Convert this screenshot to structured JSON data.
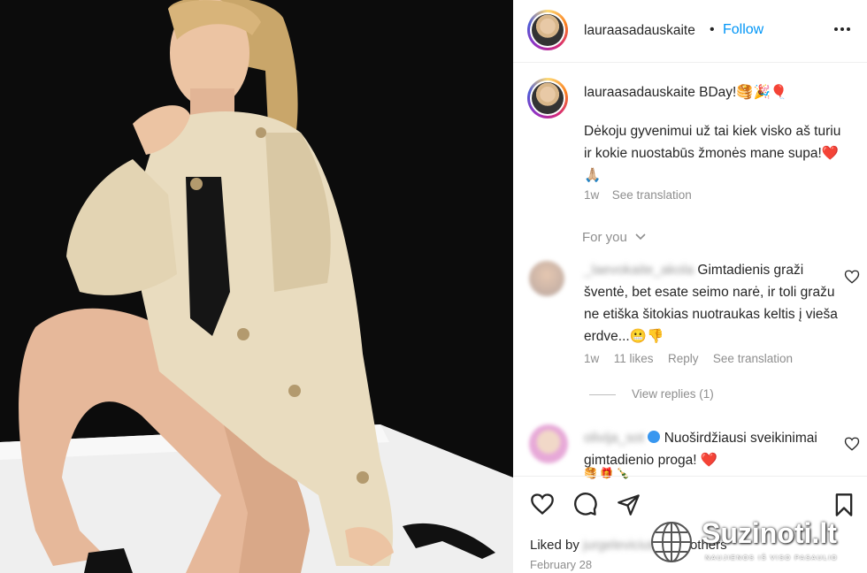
{
  "post": {
    "author": "lauraasadauskaite",
    "separator": "•",
    "follow_label": "Follow",
    "more_icon": "ellipsis-icon",
    "caption": {
      "author": "lauraasadauskaite",
      "text_lead": "BDay!🥞🎉🎈",
      "body": "Dėkoju gyvenimui už tai kiek visko aš turiu ir kokie nuostabūs žmonės mane supa!❤️🙏🏼",
      "time": "1w",
      "see_translation": "See translation"
    },
    "section_label": "For you",
    "comments": [
      {
        "user": "_laevokaite_akola",
        "text": "Gimtadienis graži šventė, bet esate seimo narė, ir toli gražu ne etiška šitokias nuotraukas keltis į vieša erdve...😬👎",
        "time": "1w",
        "likes": "11 likes",
        "reply": "Reply",
        "see_translation": "See translation",
        "view_replies": "View replies (1)"
      },
      {
        "user": "olivija_sot",
        "text": "Nuoširdžiausi sveikinimai gimtadienio proga! ❤️",
        "extra": "🥞 🎁 🍾"
      }
    ],
    "liked_by": "Liked by",
    "liked_user": "jurgeleviciute",
    "liked_tail": "and others",
    "date": "February 28"
  },
  "watermark": {
    "brand": "Suzinoti.lt",
    "tagline": "NAUJIENOS IŠ VISO PASAULIO"
  },
  "colors": {
    "follow": "#0095f6",
    "heart": "#e0002b",
    "text": "#262626",
    "muted": "#8e8e8e"
  }
}
